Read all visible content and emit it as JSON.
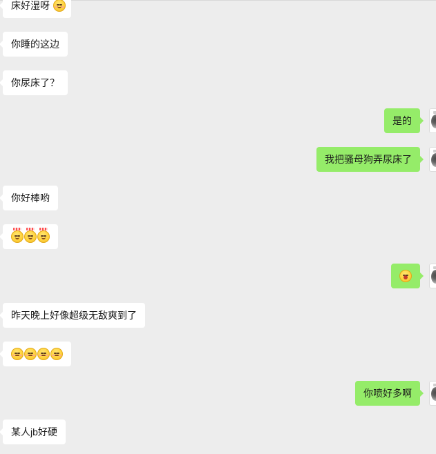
{
  "conversation": {
    "messages": [
      {
        "side": "left",
        "text": "床好湿呀",
        "emoji_after": "wink-emoji-icon"
      },
      {
        "side": "left",
        "text": "你睡的这边"
      },
      {
        "side": "left",
        "text": "你尿床了？"
      },
      {
        "side": "right",
        "text": "是的"
      },
      {
        "side": "right",
        "text": "我把骚母狗弄尿床了"
      },
      {
        "side": "left",
        "text": "你好棒哟"
      },
      {
        "side": "left",
        "text": "",
        "emojis": [
          "crying-emoji-icon",
          "crying-emoji-icon",
          "crying-emoji-icon"
        ]
      },
      {
        "side": "right",
        "text": "",
        "emojis": [
          "surprised-emoji-icon"
        ]
      },
      {
        "side": "left",
        "text": "昨天晚上好像超级无敌爽到了"
      },
      {
        "side": "left",
        "text": "",
        "emojis": [
          "pensive-emoji-icon",
          "pensive-emoji-icon",
          "pensive-emoji-icon",
          "pensive-emoji-icon"
        ]
      },
      {
        "side": "right",
        "text": "你喷好多啊"
      },
      {
        "side": "left",
        "text": "某人jb好硬"
      }
    ]
  },
  "colors": {
    "background": "#ededed",
    "incoming_bubble": "#ffffff",
    "outgoing_bubble": "#95ec69",
    "text": "#1a1a1a"
  }
}
